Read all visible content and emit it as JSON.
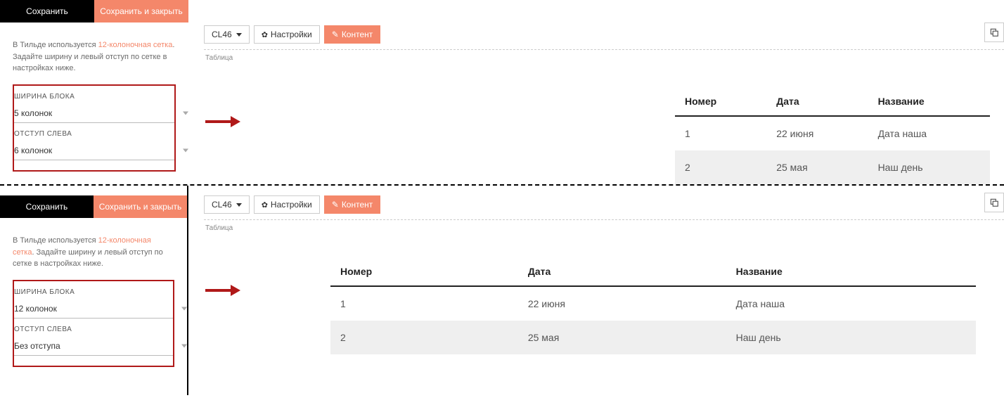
{
  "buttons": {
    "save": "Сохранить",
    "save_close": "Сохранить и закрыть"
  },
  "description": {
    "pre": "В Тильде используется ",
    "highlight": "12-колоночная сетка",
    "post": ". Задайте ширину и левый отступ по сетке в настройках ниже."
  },
  "labels": {
    "width": "ШИРИНА БЛОКА",
    "offset": "ОТСТУП СЛЕВА"
  },
  "example1": {
    "width_value": "5 колонок",
    "offset_value": "6 колонок"
  },
  "example2": {
    "width_value": "12 колонок",
    "offset_value": "Без отступа"
  },
  "toolbar": {
    "code": "CL46",
    "settings": "Настройки",
    "content": "Контент",
    "block_label": "Таблица"
  },
  "table": {
    "headers": {
      "num": "Номер",
      "date": "Дата",
      "name": "Название"
    },
    "rows": [
      {
        "num": "1",
        "date": "22 июня",
        "name": "Дата наша"
      },
      {
        "num": "2",
        "date": "25 мая",
        "name": "Наш день"
      }
    ]
  }
}
